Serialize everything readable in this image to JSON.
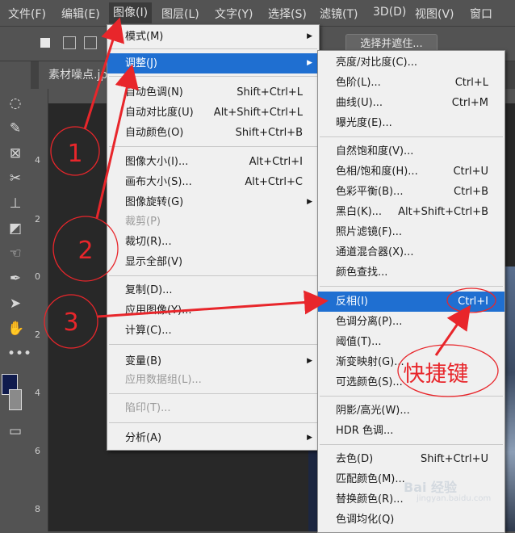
{
  "menubar": {
    "items": [
      "文件(F)",
      "编辑(E)",
      "图像(I)",
      "图层(L)",
      "文字(Y)",
      "选择(S)",
      "滤镜(T)",
      "3D(D)",
      "视图(V)",
      "窗口"
    ]
  },
  "options": {
    "select_and_mask": "选择并遮住..."
  },
  "tab": {
    "title": "素材噪点.jp"
  },
  "ruler": {
    "marks": [
      "4",
      "2",
      "0",
      "2",
      "4",
      "6",
      "8"
    ]
  },
  "image_menu": {
    "items": [
      {
        "label": "模式(M)",
        "shortcut": "",
        "submenu": true
      },
      {
        "label": "调整(J)",
        "shortcut": "",
        "submenu": true,
        "highlight": true
      },
      {
        "label": "自动色调(N)",
        "shortcut": "Shift+Ctrl+L"
      },
      {
        "label": "自动对比度(U)",
        "shortcut": "Alt+Shift+Ctrl+L"
      },
      {
        "label": "自动颜色(O)",
        "shortcut": "Shift+Ctrl+B"
      },
      {
        "label": "图像大小(I)...",
        "shortcut": "Alt+Ctrl+I"
      },
      {
        "label": "画布大小(S)...",
        "shortcut": "Alt+Ctrl+C"
      },
      {
        "label": "图像旋转(G)",
        "shortcut": "",
        "submenu": true
      },
      {
        "label": "裁剪(P)",
        "shortcut": "",
        "disabled": true
      },
      {
        "label": "裁切(R)...",
        "shortcut": ""
      },
      {
        "label": "显示全部(V)",
        "shortcut": ""
      },
      {
        "label": "复制(D)...",
        "shortcut": ""
      },
      {
        "label": "应用图像(Y)...",
        "shortcut": ""
      },
      {
        "label": "计算(C)...",
        "shortcut": ""
      },
      {
        "label": "变量(B)",
        "shortcut": "",
        "submenu": true
      },
      {
        "label": "应用数据组(L)...",
        "shortcut": "",
        "disabled": true
      },
      {
        "label": "陷印(T)...",
        "shortcut": "",
        "disabled": true
      },
      {
        "label": "分析(A)",
        "shortcut": "",
        "submenu": true
      }
    ]
  },
  "adjust_menu": {
    "items": [
      {
        "label": "亮度/对比度(C)...",
        "shortcut": ""
      },
      {
        "label": "色阶(L)...",
        "shortcut": "Ctrl+L"
      },
      {
        "label": "曲线(U)...",
        "shortcut": "Ctrl+M"
      },
      {
        "label": "曝光度(E)...",
        "shortcut": ""
      },
      {
        "label": "自然饱和度(V)...",
        "shortcut": ""
      },
      {
        "label": "色相/饱和度(H)...",
        "shortcut": "Ctrl+U"
      },
      {
        "label": "色彩平衡(B)...",
        "shortcut": "Ctrl+B"
      },
      {
        "label": "黑白(K)...",
        "shortcut": "Alt+Shift+Ctrl+B"
      },
      {
        "label": "照片滤镜(F)...",
        "shortcut": ""
      },
      {
        "label": "通道混合器(X)...",
        "shortcut": ""
      },
      {
        "label": "颜色查找...",
        "shortcut": ""
      },
      {
        "label": "反相(I)",
        "shortcut": "Ctrl+I",
        "highlight": true
      },
      {
        "label": "色调分离(P)...",
        "shortcut": ""
      },
      {
        "label": "阈值(T)...",
        "shortcut": ""
      },
      {
        "label": "渐变映射(G)...",
        "shortcut": ""
      },
      {
        "label": "可选颜色(S)...",
        "shortcut": ""
      },
      {
        "label": "阴影/高光(W)...",
        "shortcut": ""
      },
      {
        "label": "HDR 色调...",
        "shortcut": ""
      },
      {
        "label": "去色(D)",
        "shortcut": "Shift+Ctrl+U"
      },
      {
        "label": "匹配颜色(M)...",
        "shortcut": ""
      },
      {
        "label": "替换颜色(R)...",
        "shortcut": ""
      },
      {
        "label": "色调均化(Q)",
        "shortcut": ""
      }
    ]
  },
  "annotations": {
    "step1": "1",
    "step2": "2",
    "step3": "3",
    "shortcut_note": "快捷键",
    "accent": "#e8262b"
  },
  "watermark": {
    "text": "Bai 经验",
    "sub": "jingyan.baidu.com"
  }
}
